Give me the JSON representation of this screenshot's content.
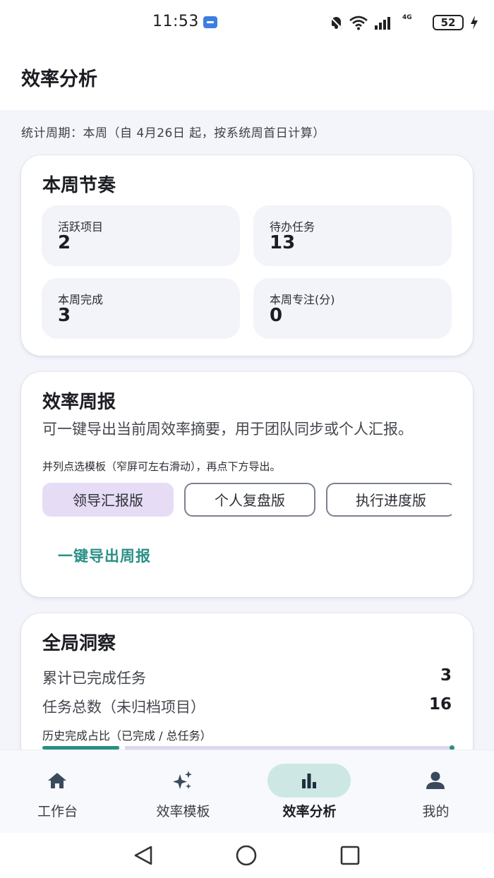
{
  "status_bar": {
    "time": "11:53",
    "battery": "52",
    "network": "4G",
    "icons": [
      "usb-icon",
      "bell-off-icon",
      "wifi-icon",
      "signal-icon",
      "4g-icon",
      "battery-icon",
      "charging-icon"
    ]
  },
  "header": {
    "title": "效率分析"
  },
  "period": "统计周期：本周（自 4月26日 起，按系统周首日计算）",
  "weekly": {
    "title": "本周节奏",
    "stats": [
      {
        "label": "活跃项目",
        "value": "2"
      },
      {
        "label": "待办任务",
        "value": "13"
      },
      {
        "label": "本周完成",
        "value": "3"
      },
      {
        "label": "本周专注(分)",
        "value": "0"
      }
    ]
  },
  "report": {
    "title": "效率周报",
    "description": "可一键导出当前周效率摘要，用于团队同步或个人汇报。",
    "hint": "并列点选模板（窄屏可左右滑动），再点下方导出。",
    "templates": [
      "领导汇报版",
      "个人复盘版",
      "执行进度版"
    ],
    "selected_template": "领导汇报版",
    "export_label": "一键导出周报"
  },
  "insights": {
    "title": "全局洞察",
    "rows": [
      {
        "label": "累计已完成任务",
        "value": "3"
      },
      {
        "label": "任务总数（未归档项目）",
        "value": "16"
      }
    ],
    "ratio_label": "历史完成占比（已完成 / 总任务）",
    "ratio_completed": 3,
    "ratio_total": 16
  },
  "bottom_nav": {
    "items": [
      {
        "label": "工作台",
        "icon": "home-icon"
      },
      {
        "label": "效率模板",
        "icon": "sparkle-icon"
      },
      {
        "label": "效率分析",
        "icon": "bar-chart-icon"
      },
      {
        "label": "我的",
        "icon": "person-icon"
      }
    ],
    "active": "效率分析"
  },
  "colors": {
    "accent": "#2a8f86",
    "chip_selected": "#e6dcf6",
    "nav_active_pill": "#cde8e4",
    "background": "#f3f5fb"
  }
}
